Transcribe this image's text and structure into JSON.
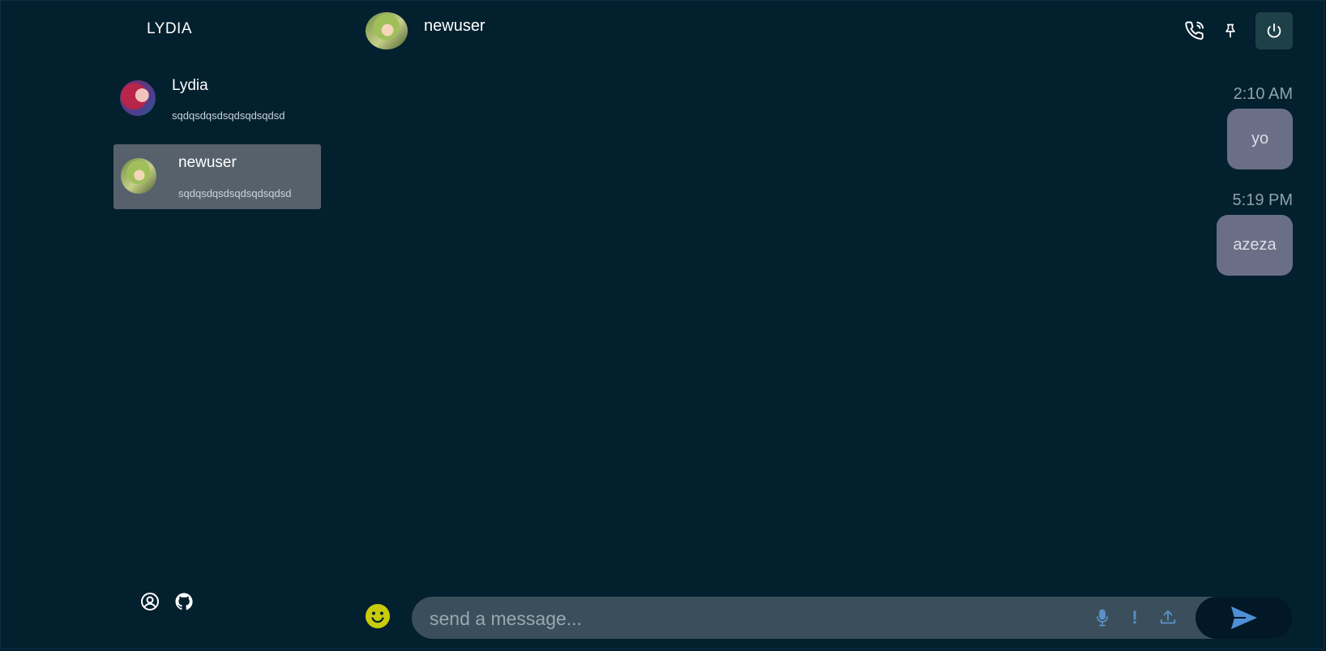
{
  "app": {
    "brand": "LYDIA"
  },
  "sidebar": {
    "contacts": [
      {
        "name": "Lydia",
        "preview": "sqdqsdqsdsqdsqdsqdsd",
        "selected": false
      },
      {
        "name": "newuser",
        "preview": "sqdqsdqsdsqdsqdsqdsd",
        "selected": true
      }
    ],
    "footer_icons": [
      "user-circle-icon",
      "github-icon"
    ]
  },
  "chat": {
    "header": {
      "name": "newuser",
      "actions": [
        "phone-call-icon",
        "pin-icon",
        "power-icon"
      ]
    },
    "messages": [
      {
        "time": "2:10 AM",
        "text": "yo"
      },
      {
        "time": "5:19 PM",
        "text": "azeza"
      }
    ]
  },
  "composer": {
    "placeholder": "send a message...",
    "value": "",
    "tools": [
      "microphone-icon",
      "exclamation-icon",
      "upload-icon"
    ],
    "emoji_icon": "smiley-icon",
    "send_icon": "send-icon",
    "alert_symbol": "!"
  },
  "colors": {
    "background": "#03202f",
    "selected_contact": "#56616b",
    "bubble": "#6a6e86",
    "composer": "#3a4f5b",
    "power_button": "#1e4048",
    "accent_icon": "#5b8fc7",
    "emoji": "#c8cc0c"
  }
}
